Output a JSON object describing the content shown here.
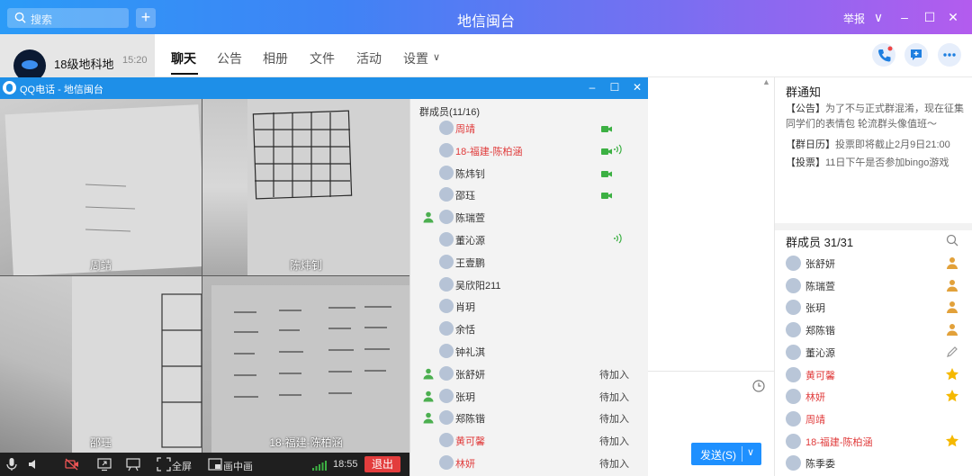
{
  "main_window": {
    "title": "地信闽台",
    "search_placeholder": "搜索",
    "add_symbol": "+",
    "report_label": "举报",
    "chevron": "∨",
    "minimize": "–",
    "maximize": "☐",
    "close": "✕"
  },
  "conversation": {
    "name": "18级地科地",
    "time": "15:20"
  },
  "tabs": {
    "items": [
      "聊天",
      "公告",
      "相册",
      "文件",
      "活动",
      "设置"
    ],
    "settings_chevron": "∨"
  },
  "group_notice": {
    "title": "群通知",
    "lines": [
      {
        "tag": "【公告】",
        "text": "为了不与正式群混淆，现在征集"
      },
      {
        "tag": "",
        "text": "同学们的表情包 轮流群头像值班～"
      },
      {
        "tag": "【群日历】",
        "text": "投票即将截止2月9日21:00"
      },
      {
        "tag": "【投票】",
        "text": "11日下午是否参加bingo游戏"
      }
    ]
  },
  "group_members": {
    "title": "群成员 31/31",
    "items": [
      {
        "name": "张舒妍",
        "red": false,
        "tag": "admin"
      },
      {
        "name": "陈瑞萱",
        "red": false,
        "tag": "admin"
      },
      {
        "name": "张玥",
        "red": false,
        "tag": "admin"
      },
      {
        "name": "郑陈锴",
        "red": false,
        "tag": "admin"
      },
      {
        "name": "董沁源",
        "red": false,
        "tag": "edit"
      },
      {
        "name": "黄可馨",
        "red": true,
        "tag": "star"
      },
      {
        "name": "林妍",
        "red": true,
        "tag": "star"
      },
      {
        "name": "周靖",
        "red": true,
        "tag": ""
      },
      {
        "name": "18-福建-陈柏涵",
        "red": true,
        "tag": "star"
      },
      {
        "name": "陈季委",
        "red": false,
        "tag": ""
      }
    ]
  },
  "send_button": {
    "label": "发送(S)",
    "chevron": "∨"
  },
  "call_window": {
    "title": "QQ电话 - 地信闽台",
    "minimize": "–",
    "maximize": "☐",
    "close": "✕",
    "tiles": [
      "周靖",
      "陈炜钊",
      "邵珏",
      "18-福建-陈柏涵"
    ],
    "toolbar": {
      "fullscreen": "全屏",
      "pip": "画中画",
      "time": "18:55",
      "hangup": "退出"
    },
    "members_title": "群成员(11/16)",
    "members": [
      {
        "name": "周靖",
        "red": true,
        "admin": false,
        "cam": true,
        "speaking": false,
        "status": ""
      },
      {
        "name": "18-福建-陈柏涵",
        "red": true,
        "admin": false,
        "cam": true,
        "speaking": true,
        "status": ""
      },
      {
        "name": "陈炜钊",
        "red": false,
        "admin": false,
        "cam": true,
        "speaking": false,
        "status": ""
      },
      {
        "name": "邵珏",
        "red": false,
        "admin": false,
        "cam": true,
        "speaking": false,
        "status": ""
      },
      {
        "name": "陈瑞萱",
        "red": false,
        "admin": true,
        "cam": false,
        "speaking": false,
        "status": ""
      },
      {
        "name": "董沁源",
        "red": false,
        "admin": false,
        "cam": false,
        "speaking": true,
        "status": ""
      },
      {
        "name": "王壹鹏",
        "red": false,
        "admin": false,
        "cam": false,
        "speaking": false,
        "status": ""
      },
      {
        "name": "吴欣阳211",
        "red": false,
        "admin": false,
        "cam": false,
        "speaking": false,
        "status": ""
      },
      {
        "name": "肖玥",
        "red": false,
        "admin": false,
        "cam": false,
        "speaking": false,
        "status": ""
      },
      {
        "name": "余恬",
        "red": false,
        "admin": false,
        "cam": false,
        "speaking": false,
        "status": ""
      },
      {
        "name": "钟礼淇",
        "red": false,
        "admin": false,
        "cam": false,
        "speaking": false,
        "status": ""
      },
      {
        "name": "张舒妍",
        "red": false,
        "admin": true,
        "cam": false,
        "speaking": false,
        "status": "待加入"
      },
      {
        "name": "张玥",
        "red": false,
        "admin": true,
        "cam": false,
        "speaking": false,
        "status": "待加入"
      },
      {
        "name": "郑陈锴",
        "red": false,
        "admin": true,
        "cam": false,
        "speaking": false,
        "status": "待加入"
      },
      {
        "name": "黄可馨",
        "red": true,
        "admin": false,
        "cam": false,
        "speaking": false,
        "status": "待加入"
      },
      {
        "name": "林妍",
        "red": true,
        "admin": false,
        "cam": false,
        "speaking": false,
        "status": "待加入"
      }
    ]
  },
  "colors": {
    "accent": "#1e90ff",
    "member_red": "#e03b3b",
    "cam_green": "#3cb043",
    "admin_green": "#4caf50",
    "star_yellow": "#f5b800",
    "hangup_red": "#e33d3d"
  }
}
